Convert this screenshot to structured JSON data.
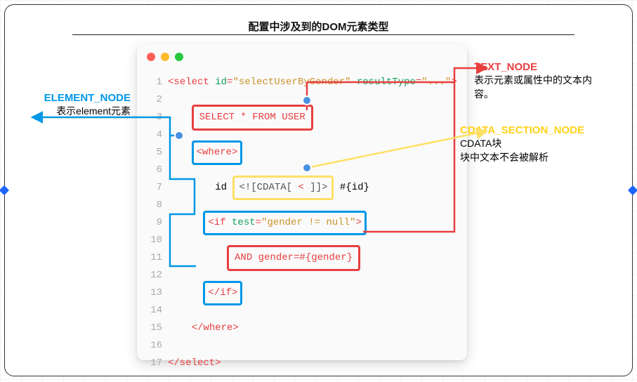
{
  "title": "配置中涉及到的DOM元素类型",
  "annotations": {
    "element_node": {
      "label": "ELEMENT_NODE",
      "desc": "表示element元素"
    },
    "text_node": {
      "label": "TEXT_NODE",
      "desc": "表示元素或属性中的文本内容。"
    },
    "cdata_node": {
      "label": "CDATA_SECTION_NODE",
      "desc": "CDATA块\n块中文本不会被解析"
    }
  },
  "code": {
    "line1_parts": {
      "open": "<select ",
      "attr_id": "id",
      "eq1": "=",
      "val_id": "\"selectUserByGender\"",
      "attr_rt": " resultType",
      "eq2": "=",
      "val_rt": "\"...\"",
      "close": ">"
    },
    "line3": "SELECT * FROM USER",
    "line5_where_open": "<where>",
    "line7": {
      "prefix": "id ",
      "cdata_open": "<![CDATA[ ",
      "cdata_content": "< ",
      "cdata_close": "]]>",
      "suffix": " #{id}"
    },
    "line9": {
      "if_open": "<if ",
      "attr": "test",
      "eq": "=",
      "val": "\"gender != null\"",
      "close": ">"
    },
    "line11": "AND gender=#{gender}",
    "line13_if_close": "</if>",
    "line15_where_close": "</where>",
    "line17_select_close": "</select>"
  },
  "line_numbers": [
    "1",
    "2",
    "3",
    "4",
    "5",
    "6",
    "7",
    "8",
    "9",
    "10",
    "11",
    "12",
    "13",
    "14",
    "15",
    "16",
    "17"
  ]
}
